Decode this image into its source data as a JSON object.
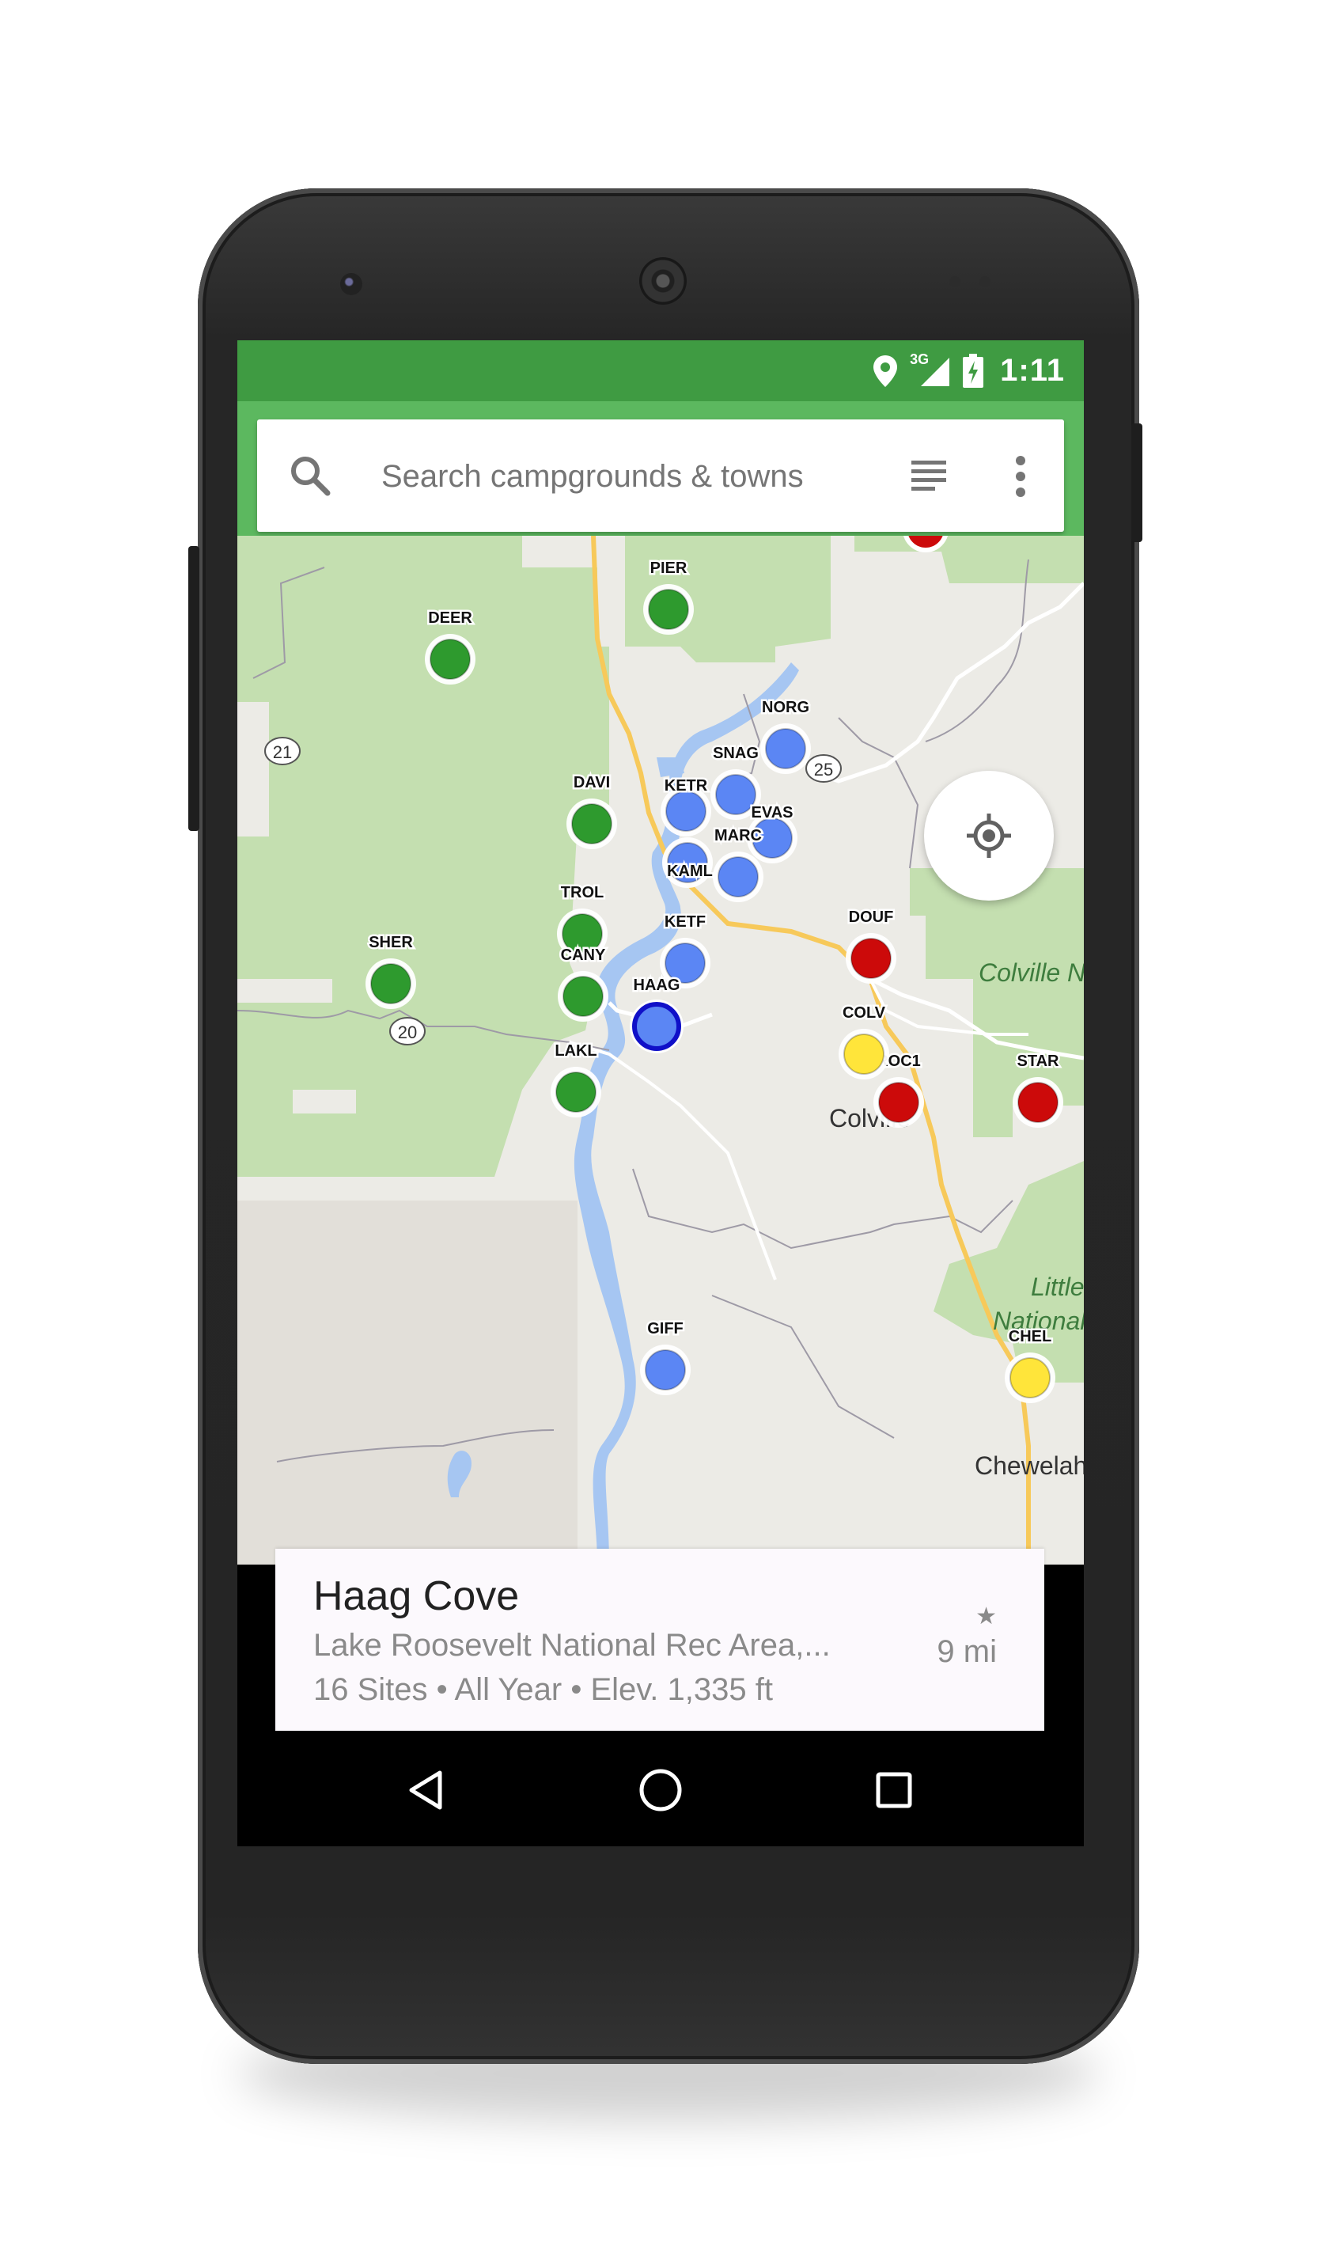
{
  "status_bar": {
    "time": "1:11",
    "network": "3G"
  },
  "search": {
    "placeholder": "Search campgrounds & towns"
  },
  "map": {
    "places": [
      {
        "name": "Colville",
        "type": "town"
      },
      {
        "name": "Chewelah",
        "type": "town"
      },
      {
        "name": "Colville N",
        "type": "forest"
      },
      {
        "name": "Little",
        "type": "forest"
      },
      {
        "name": "National",
        "type": "forest"
      }
    ],
    "route_shields": [
      "21",
      "25",
      "20"
    ],
    "campsites": [
      {
        "code": "PIER",
        "color": "#2e9a2e"
      },
      {
        "code": "DEER",
        "color": "#2e9a2e"
      },
      {
        "code": "DAVI",
        "color": "#2e9a2e"
      },
      {
        "code": "TROL",
        "color": "#2e9a2e"
      },
      {
        "code": "CANY",
        "color": "#2e9a2e"
      },
      {
        "code": "SHER",
        "color": "#2e9a2e"
      },
      {
        "code": "LAKL",
        "color": "#2e9a2e"
      },
      {
        "code": "NORG",
        "color": "#5b86f4"
      },
      {
        "code": "SNAG",
        "color": "#5b86f4"
      },
      {
        "code": "KETR",
        "color": "#5b86f4"
      },
      {
        "code": "EVAS",
        "color": "#5b86f4"
      },
      {
        "code": "KAML",
        "color": "#5b86f4"
      },
      {
        "code": "MARC",
        "color": "#5b86f4"
      },
      {
        "code": "KETF",
        "color": "#5b86f4"
      },
      {
        "code": "HAAG",
        "color": "#5b86f4",
        "selected": true
      },
      {
        "code": "GIFF",
        "color": "#5b86f4"
      },
      {
        "code": "DOUF",
        "color": "#cc0a0a"
      },
      {
        "code": "ROC1",
        "color": "#cc0a0a"
      },
      {
        "code": "STAR",
        "color": "#cc0a0a"
      },
      {
        "code": "COLV",
        "color": "#ffe53a"
      },
      {
        "code": "CHEL",
        "color": "#ffe53a"
      }
    ]
  },
  "card": {
    "name": "Haag Cove",
    "area": "Lake Roosevelt National Rec Area,...",
    "details": "16 Sites • All Year • Elev. 1,335 ft",
    "distance": "9 mi"
  },
  "colors": {
    "status_bar": "#3f9b42",
    "app_bar": "#5cb85f",
    "forest": "#c4dfb0",
    "water": "#a6c6f2"
  }
}
